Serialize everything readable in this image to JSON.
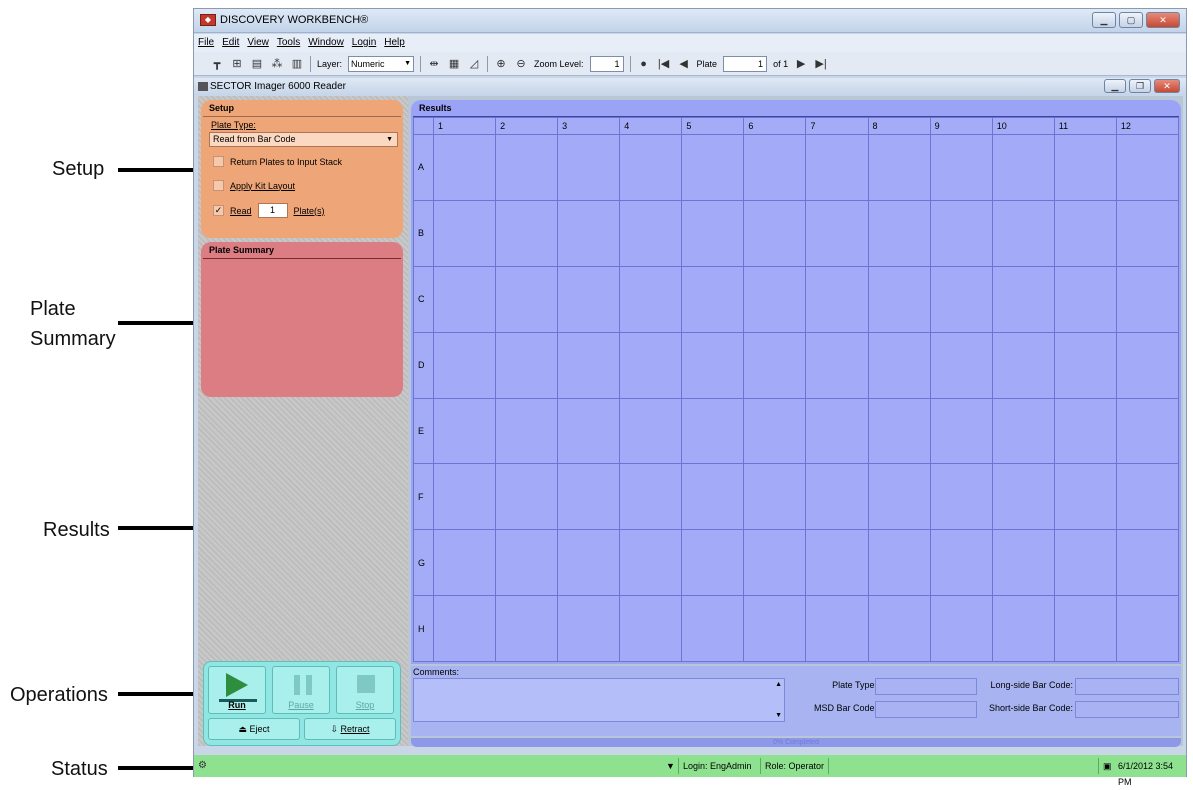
{
  "annotations": {
    "setup": "Setup",
    "plate_summary_line1": "Plate",
    "plate_summary_line2": "Summary",
    "results": "Results",
    "operations": "Operations",
    "status": "Status"
  },
  "app": {
    "title": "DISCOVERY WORKBENCH®",
    "menu": [
      "File",
      "Edit",
      "View",
      "Tools",
      "Window",
      "Login",
      "Help"
    ],
    "toolbar": {
      "layer_label": "Layer:",
      "layer_value": "Numeric",
      "zoom_label": "Zoom Level:",
      "zoom_value": "1",
      "plate_label": "Plate",
      "plate_value": "1",
      "plate_of": "of 1"
    }
  },
  "reader": {
    "title": "SECTOR Imager 6000 Reader",
    "setup": {
      "title": "Setup",
      "plate_type_label": "Plate Type:",
      "plate_type_value": "Read from Bar Code",
      "return_plates": "Return Plates to Input Stack",
      "apply_kit": "Apply Kit Layout",
      "read_label": "Read",
      "read_value": "1",
      "plates_label": "Plate(s)"
    },
    "plate_summary": {
      "title": "Plate Summary"
    },
    "operations": {
      "run": "Run",
      "pause": "Pause",
      "stop": "Stop",
      "eject": "Eject",
      "retract": "Retract"
    },
    "results": {
      "title": "Results",
      "columns": [
        "1",
        "2",
        "3",
        "4",
        "5",
        "6",
        "7",
        "8",
        "9",
        "10",
        "11",
        "12"
      ],
      "rows": [
        "A",
        "B",
        "C",
        "D",
        "E",
        "F",
        "G",
        "H"
      ]
    },
    "comments": {
      "label": "Comments:",
      "plate_type_label": "Plate Type:",
      "msd_barcode_label": "MSD Bar Code:",
      "long_side_label": "Long-side Bar Code:",
      "short_side_label": "Short-side Bar Code:",
      "progress": "0% Completed"
    }
  },
  "status": {
    "login": "Login: EngAdmin",
    "role": "Role: Operator",
    "datetime": "6/1/2012 3:54 PM"
  }
}
